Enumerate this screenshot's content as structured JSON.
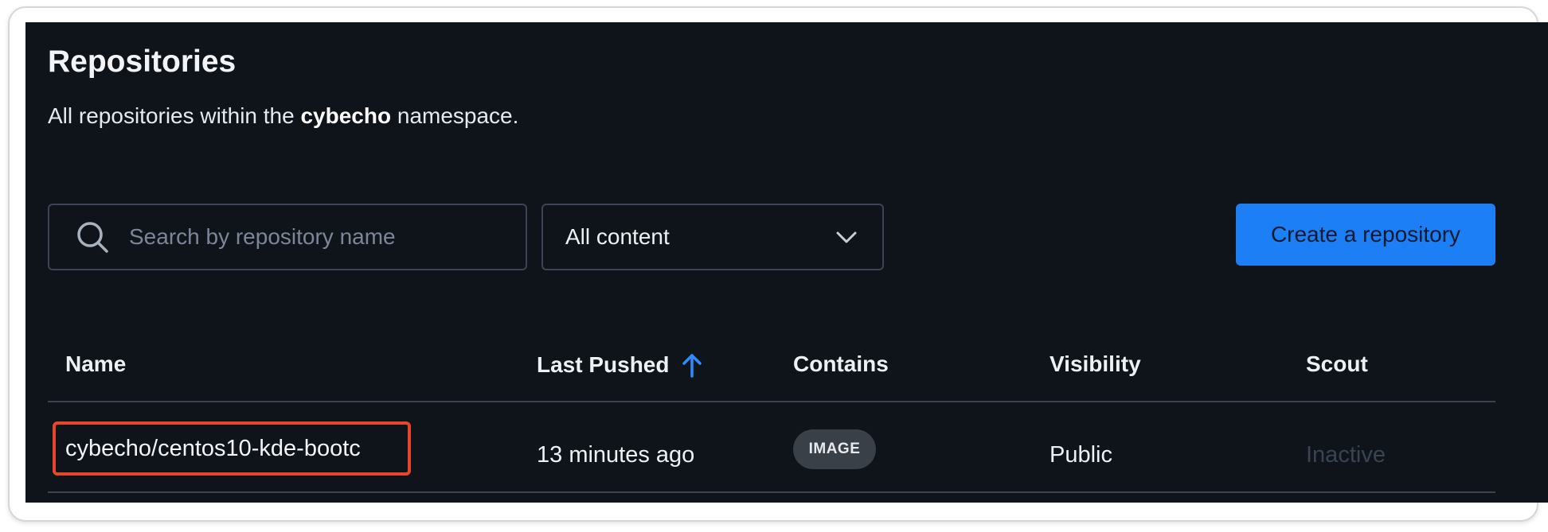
{
  "header": {
    "title": "Repositories",
    "subtitle_prefix": "All repositories within the",
    "namespace": "cybecho",
    "subtitle_suffix": "namespace."
  },
  "search": {
    "placeholder": "Search by repository name",
    "value": ""
  },
  "filter": {
    "selected": "All content"
  },
  "actions": {
    "create_label": "Create a repository"
  },
  "table": {
    "columns": [
      "Name",
      "Last Pushed",
      "Contains",
      "Visibility",
      "Scout"
    ],
    "sort_column": "Last Pushed",
    "sort_direction": "ascending",
    "rows": [
      {
        "name": "cybecho/centos10-kde-bootc",
        "last_pushed": "13 minutes ago",
        "contains": "IMAGE",
        "visibility": "Public",
        "scout": "Inactive"
      }
    ]
  },
  "colors": {
    "background": "#0f141b",
    "accent": "#1d7ff5",
    "highlight": "#e8452a",
    "badge": "#3a4048"
  },
  "icons": {
    "search": "search-icon",
    "dropdown": "chevron-down-icon",
    "sort": "arrow-up-icon"
  }
}
